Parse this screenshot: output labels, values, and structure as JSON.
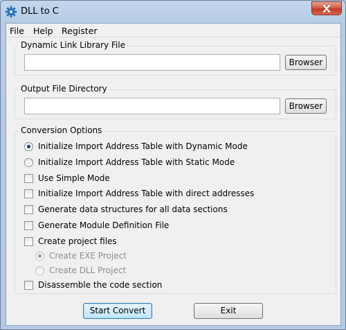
{
  "window": {
    "title": "DLL to C"
  },
  "menu": {
    "items": [
      "File",
      "Help",
      "Register"
    ]
  },
  "dll_group": {
    "label": "Dynamic Link Library File",
    "value": "",
    "browse_label": "Browser"
  },
  "output_group": {
    "label": "Output File Directory",
    "value": "",
    "browse_label": "Browser"
  },
  "options_group": {
    "label": "Conversion Options",
    "items": [
      {
        "type": "radio",
        "label": "Initialize Import Address Table with Dynamic Mode",
        "checked": true
      },
      {
        "type": "radio",
        "label": "Initialize Import Address Table with Static Mode",
        "checked": false
      },
      {
        "type": "checkbox",
        "label": "Use Simple Mode",
        "checked": false
      },
      {
        "type": "checkbox",
        "label": "Initialize Import Address Table with direct addresses",
        "checked": false
      },
      {
        "type": "checkbox",
        "label": "Generate data structures for all data sections",
        "checked": false
      },
      {
        "type": "checkbox",
        "label": "Generate Module Definition File",
        "checked": false
      },
      {
        "type": "checkbox",
        "label": "Create project files",
        "checked": false
      },
      {
        "type": "radio",
        "label": "Create EXE Project",
        "checked": true,
        "disabled": true
      },
      {
        "type": "radio",
        "label": "Create DLL Project",
        "checked": false,
        "disabled": true
      },
      {
        "type": "checkbox",
        "label": "Disassemble the code section",
        "checked": false
      }
    ]
  },
  "buttons": {
    "start_label": "Start Convert",
    "exit_label": "Exit"
  }
}
